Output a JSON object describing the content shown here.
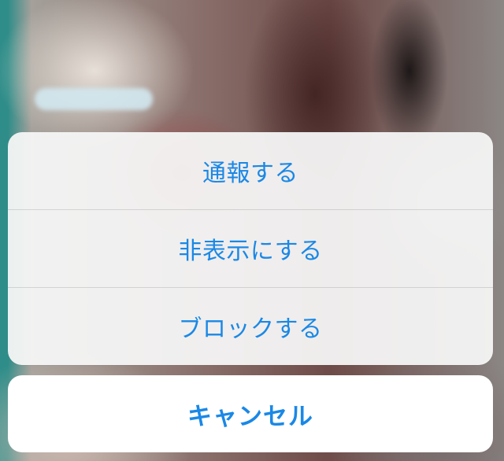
{
  "action_sheet": {
    "items": [
      {
        "label": "通報する"
      },
      {
        "label": "非表示にする"
      },
      {
        "label": "ブロックする"
      }
    ],
    "cancel_label": "キャンセル"
  },
  "colors": {
    "action_text": "#1a88e6",
    "sheet_background": "#f6f6f6",
    "cancel_background": "#ffffff"
  }
}
